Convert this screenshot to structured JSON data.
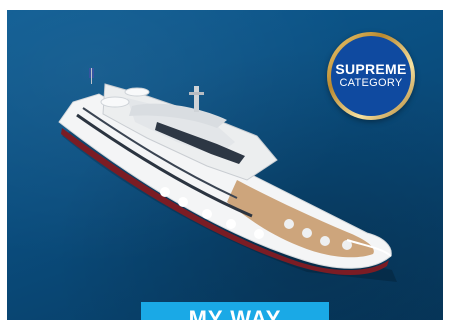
{
  "badge": {
    "title": "SUPREME",
    "subtitle": "CATEGORY"
  },
  "cta": {
    "label": "MY WAY"
  },
  "image": {
    "subject": "ship-photo"
  },
  "colors": {
    "sea": "#0a4d7e",
    "badge_bg": "#0f4aa0",
    "badge_ring": "#c9a24a",
    "cta_bg": "#1aa9e6",
    "ship_hull": "#f2f2f2",
    "deck_wood": "#c9a27a"
  }
}
